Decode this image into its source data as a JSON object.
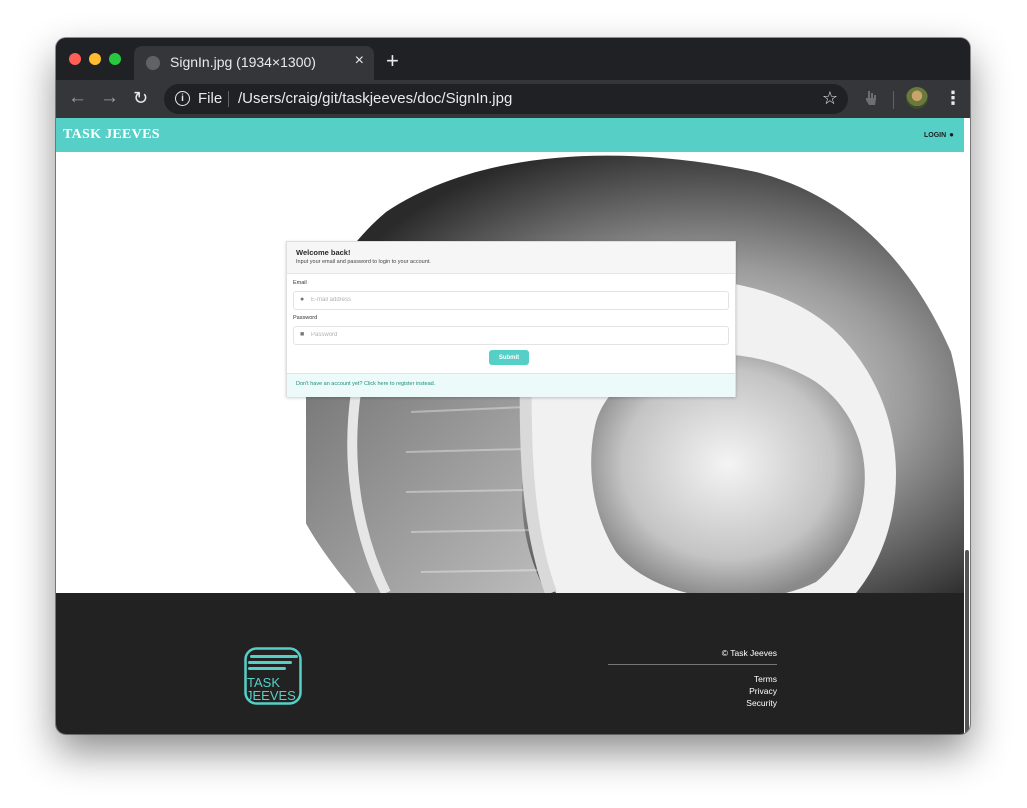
{
  "browser": {
    "tab_title": "SignIn.jpg (1934×1300)",
    "tab_close": "×",
    "new_tab": "+",
    "scheme": "File",
    "url": "/Users/craig/git/taskjeeves/doc/SignIn.jpg",
    "back_glyph": "←",
    "forward_glyph": "→",
    "reload_glyph": "↻",
    "star_glyph": "☆",
    "menu_glyph": "⋮",
    "info_glyph": "i"
  },
  "site": {
    "brand": "TASK JEEVES",
    "login_label": "LOGIN",
    "accent_color": "#56cfc7"
  },
  "signin": {
    "title": "Welcome back!",
    "subtitle": "Input your email and password to login to your account.",
    "email_label": "Email",
    "email_placeholder": "E-mail address",
    "email_value": "",
    "password_label": "Password",
    "password_placeholder": "Password",
    "password_value": "",
    "submit_label": "Submit",
    "register_text": "Don't have an account yet? Click here to register instead."
  },
  "footer": {
    "logo_text_line1": "TASK",
    "logo_text_line2": "JEEVES",
    "copyright": "© Task Jeeves",
    "links": [
      "Terms",
      "Privacy",
      "Security"
    ]
  }
}
